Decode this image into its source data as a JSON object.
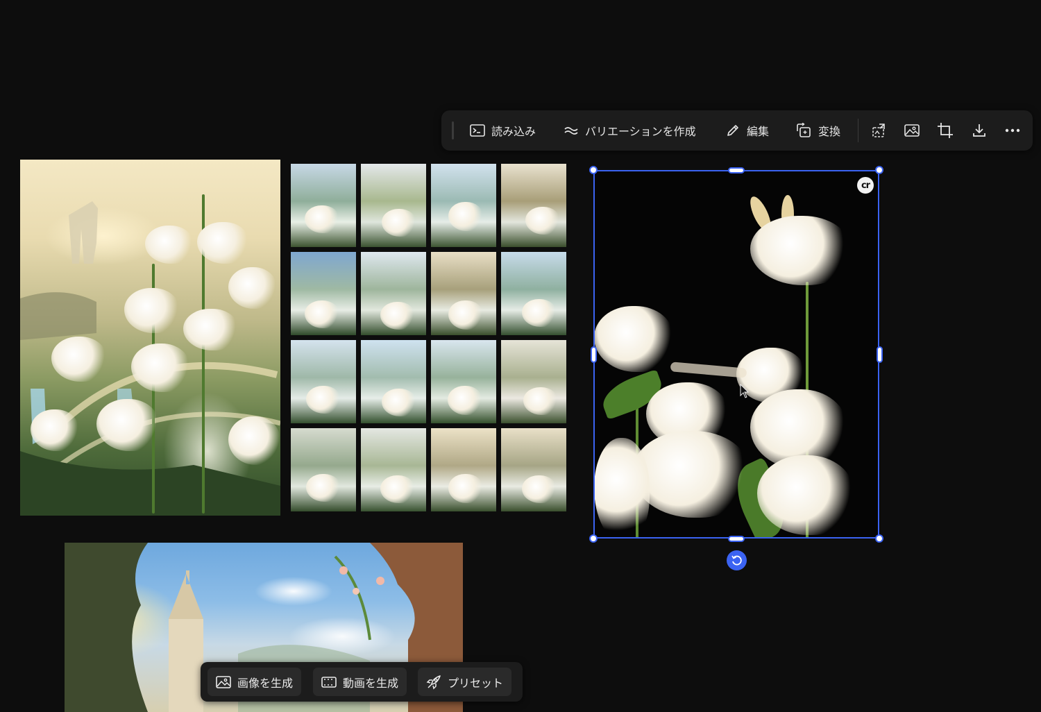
{
  "toolbar": {
    "import_label": "読み込み",
    "variation_label": "バリエーションを作成",
    "edit_label": "編集",
    "convert_label": "変換",
    "icons": [
      "expand-image-icon",
      "image-icon",
      "crop-icon",
      "download-icon",
      "more-icon"
    ]
  },
  "selection": {
    "badge_text": "cr"
  },
  "generate_bar": {
    "image_label": "画像を生成",
    "video_label": "動画を生成",
    "preset_label": "プリセット"
  },
  "colors": {
    "background": "#0d0d0d",
    "toolbar_bg": "#1c1c1c",
    "selection_accent": "#3b63f2"
  }
}
